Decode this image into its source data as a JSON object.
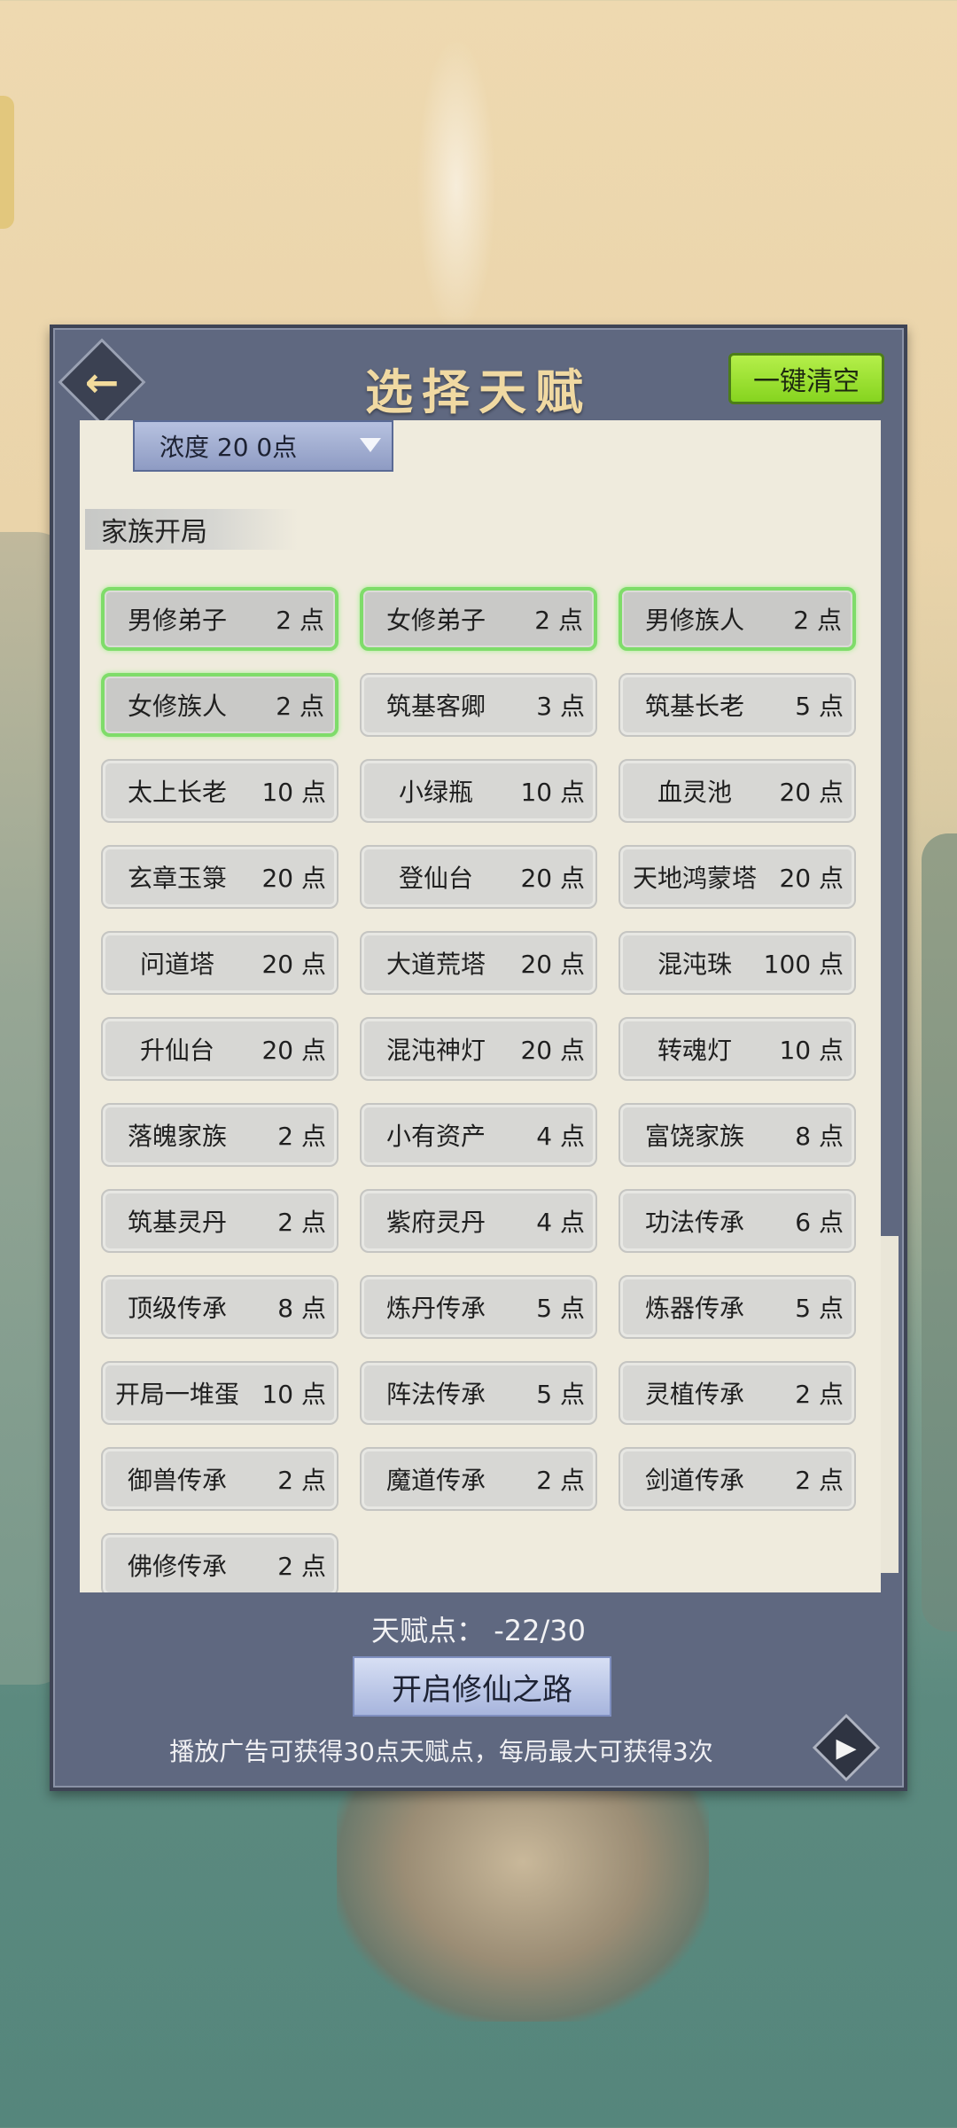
{
  "header": {
    "back_icon": "arrow-left-icon",
    "title": "选择天赋",
    "clear_label": "一键清空"
  },
  "filter": {
    "dropdown_value": "浓度  20  0点"
  },
  "section": {
    "title": "家族开局"
  },
  "talents": [
    {
      "name": "男修弟子",
      "points": "2 点",
      "selected": true
    },
    {
      "name": "女修弟子",
      "points": "2 点",
      "selected": true
    },
    {
      "name": "男修族人",
      "points": "2 点",
      "selected": true
    },
    {
      "name": "女修族人",
      "points": "2 点",
      "selected": true
    },
    {
      "name": "筑基客卿",
      "points": "3 点",
      "selected": false
    },
    {
      "name": "筑基长老",
      "points": "5 点",
      "selected": false
    },
    {
      "name": "太上长老",
      "points": "10 点",
      "selected": false
    },
    {
      "name": "小绿瓶",
      "points": "10 点",
      "selected": false
    },
    {
      "name": "血灵池",
      "points": "20 点",
      "selected": false
    },
    {
      "name": "玄章玉箓",
      "points": "20 点",
      "selected": false
    },
    {
      "name": "登仙台",
      "points": "20 点",
      "selected": false
    },
    {
      "name": "天地鸿蒙塔",
      "points": "20 点",
      "selected": false
    },
    {
      "name": "问道塔",
      "points": "20 点",
      "selected": false
    },
    {
      "name": "大道荒塔",
      "points": "20 点",
      "selected": false
    },
    {
      "name": "混沌珠",
      "points": "100 点",
      "selected": false
    },
    {
      "name": "升仙台",
      "points": "20 点",
      "selected": false
    },
    {
      "name": "混沌神灯",
      "points": "20 点",
      "selected": false
    },
    {
      "name": "转魂灯",
      "points": "10 点",
      "selected": false
    },
    {
      "name": "落魄家族",
      "points": "2 点",
      "selected": false
    },
    {
      "name": "小有资产",
      "points": "4 点",
      "selected": false
    },
    {
      "name": "富饶家族",
      "points": "8 点",
      "selected": false
    },
    {
      "name": "筑基灵丹",
      "points": "2 点",
      "selected": false
    },
    {
      "name": "紫府灵丹",
      "points": "4 点",
      "selected": false
    },
    {
      "name": "功法传承",
      "points": "6 点",
      "selected": false
    },
    {
      "name": "顶级传承",
      "points": "8 点",
      "selected": false
    },
    {
      "name": "炼丹传承",
      "points": "5 点",
      "selected": false
    },
    {
      "name": "炼器传承",
      "points": "5 点",
      "selected": false
    },
    {
      "name": "开局一堆蛋",
      "points": "10 点",
      "selected": false
    },
    {
      "name": "阵法传承",
      "points": "5 点",
      "selected": false
    },
    {
      "name": "灵植传承",
      "points": "2 点",
      "selected": false
    },
    {
      "name": "御兽传承",
      "points": "2 点",
      "selected": false
    },
    {
      "name": "魔道传承",
      "points": "2 点",
      "selected": false
    },
    {
      "name": "剑道传承",
      "points": "2 点",
      "selected": false
    },
    {
      "name": "佛修传承",
      "points": "2 点",
      "selected": false
    }
  ],
  "footer": {
    "points_label": "天赋点：",
    "points_value": "-22/30",
    "start_label": "开启修仙之路",
    "ad_text": "播放广告可获得30点天赋点，每局最大可获得3次",
    "play_icon": "play-icon"
  },
  "colors": {
    "panel": "#5f6880",
    "content_bg": "#efebdd",
    "selected_border": "#7fdc6a",
    "clear_button": "#9be235",
    "title_gold": "#f0d9a2"
  }
}
